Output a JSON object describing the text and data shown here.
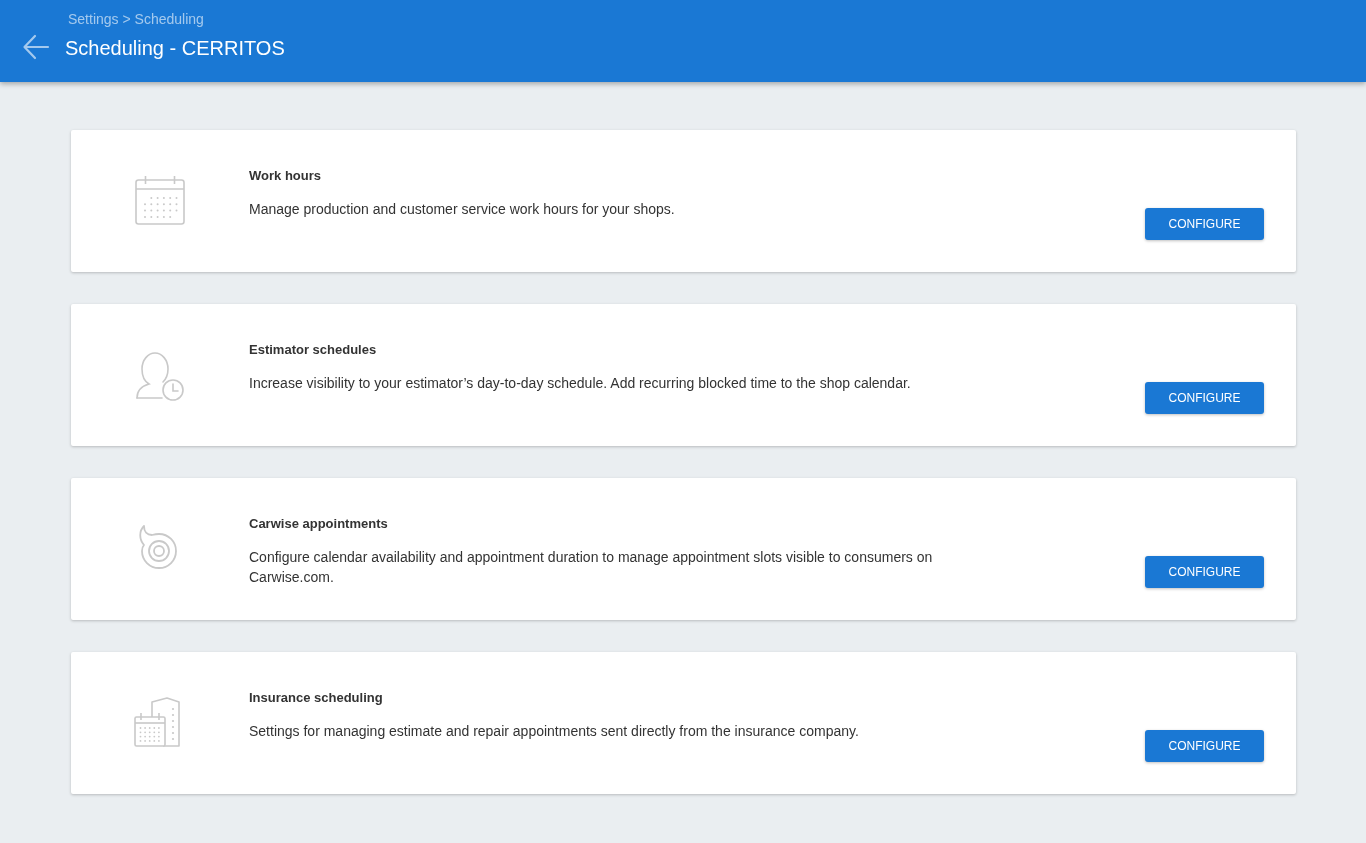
{
  "header": {
    "breadcrumb": "Settings > Scheduling",
    "title": "Scheduling - CERRITOS"
  },
  "cards": [
    {
      "kind": "calendar",
      "title": "Work hours",
      "description": "Manage production and customer service work hours for your shops.",
      "button": "CONFIGURE"
    },
    {
      "kind": "person",
      "title": "Estimator schedules",
      "description": "Increase visibility to your estimator’s day-to-day schedule. Add recurring blocked time to the shop calendar.",
      "button": "CONFIGURE"
    },
    {
      "kind": "swirl",
      "title": "Carwise appointments",
      "description": "Configure calendar availability and appointment duration to manage appointment slots visible to consumers on Carwise.com.",
      "button": "CONFIGURE"
    },
    {
      "kind": "building",
      "title": "Insurance scheduling",
      "description": "Settings for managing estimate and repair appointments sent directly from the insurance company.",
      "button": "CONFIGURE"
    }
  ]
}
